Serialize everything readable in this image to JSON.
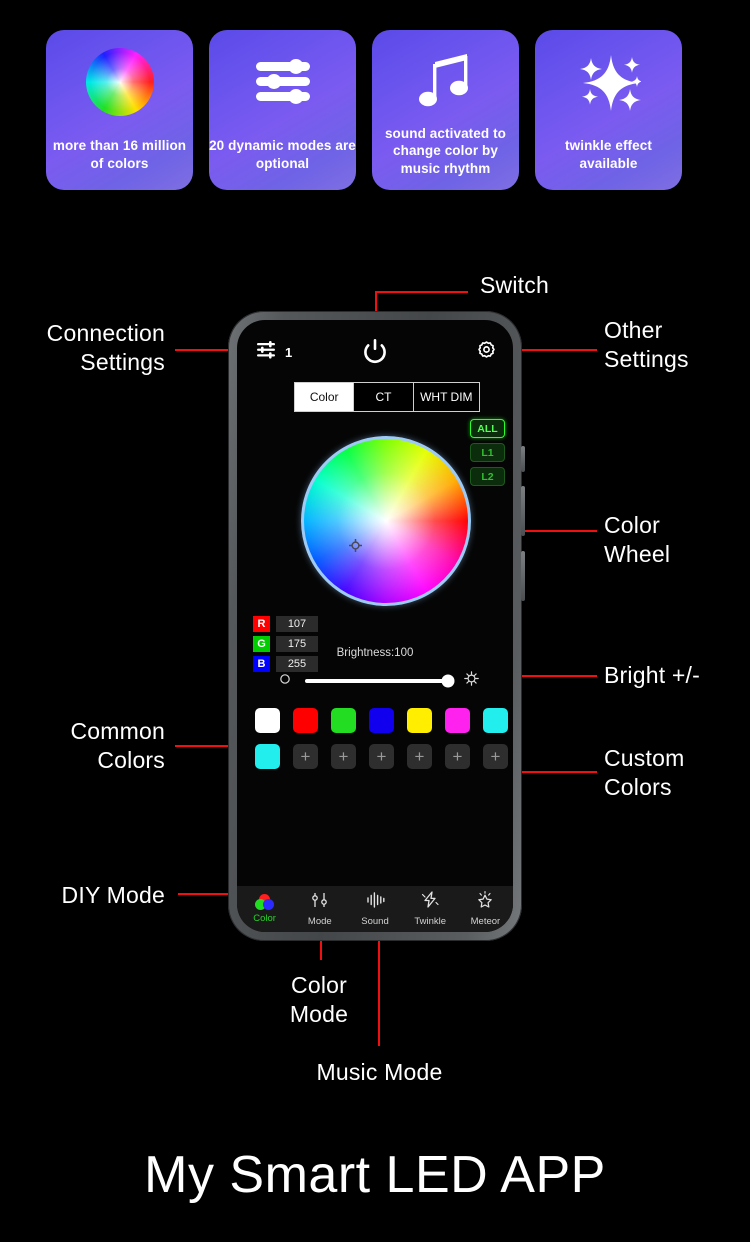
{
  "features": [
    {
      "icon": "color-wheel-icon",
      "caption": "more than 16\nmillion of colors"
    },
    {
      "icon": "sliders-icon",
      "caption": "20 dynamic\nmodes are optional"
    },
    {
      "icon": "music-note-icon",
      "caption": "sound activated\nto change color\nby music rhythm"
    },
    {
      "icon": "sparkle-icon",
      "caption": "twinkle effect\navailable"
    }
  ],
  "annotations": {
    "switch": "Switch",
    "connection_settings": "Connection\nSettings",
    "other_settings": "Other\nSettings",
    "color_wheel": "Color\nWheel",
    "bright": "Bright +/-",
    "common_colors": "Common\nColors",
    "custom_colors": "Custom\nColors",
    "diy_mode": "DIY Mode",
    "color_mode": "Color\nMode",
    "music_mode": "Music Mode"
  },
  "app": {
    "connection_count": "1",
    "power_icon": "power-icon",
    "settings_icon": "gear-icon",
    "connection_icon": "sliders-icon",
    "tabs": [
      {
        "label": "Color",
        "active": true
      },
      {
        "label": "CT",
        "active": false
      },
      {
        "label": "WHT DIM",
        "active": false
      }
    ],
    "zones": [
      {
        "label": "ALL",
        "active": true
      },
      {
        "label": "L1",
        "active": false
      },
      {
        "label": "L2",
        "active": false
      }
    ],
    "rgb": [
      {
        "key": "R",
        "value": "107",
        "color": "#ff0000"
      },
      {
        "key": "G",
        "value": "175",
        "color": "#00cc00"
      },
      {
        "key": "B",
        "value": "255",
        "color": "#0000ff"
      }
    ],
    "brightness_label": "Brightness:100",
    "brightness_value": 100,
    "common_colors": [
      "#ffffff",
      "#fe0000",
      "#22dd22",
      "#1100ee",
      "#ffee00",
      "#ff22ee",
      "#22eeee"
    ],
    "custom_colors": [
      "#22eeee",
      "+",
      "+",
      "+",
      "+",
      "+",
      "+"
    ],
    "nav": [
      {
        "label": "Color",
        "icon": "rgb-circles-icon",
        "active": true
      },
      {
        "label": "Mode",
        "icon": "sliders-icon",
        "active": false
      },
      {
        "label": "Sound",
        "icon": "waveform-icon",
        "active": false
      },
      {
        "label": "Twinkle",
        "icon": "lightning-icon",
        "active": false
      },
      {
        "label": "Meteor",
        "icon": "shooting-star-icon",
        "active": false
      }
    ]
  },
  "title": "My Smart LED APP",
  "colors": {
    "accent_line": "#f10f0f",
    "card_gradient_start": "#5b4ae8",
    "card_gradient_end": "#7f6fe2",
    "active_green": "#25d425"
  }
}
